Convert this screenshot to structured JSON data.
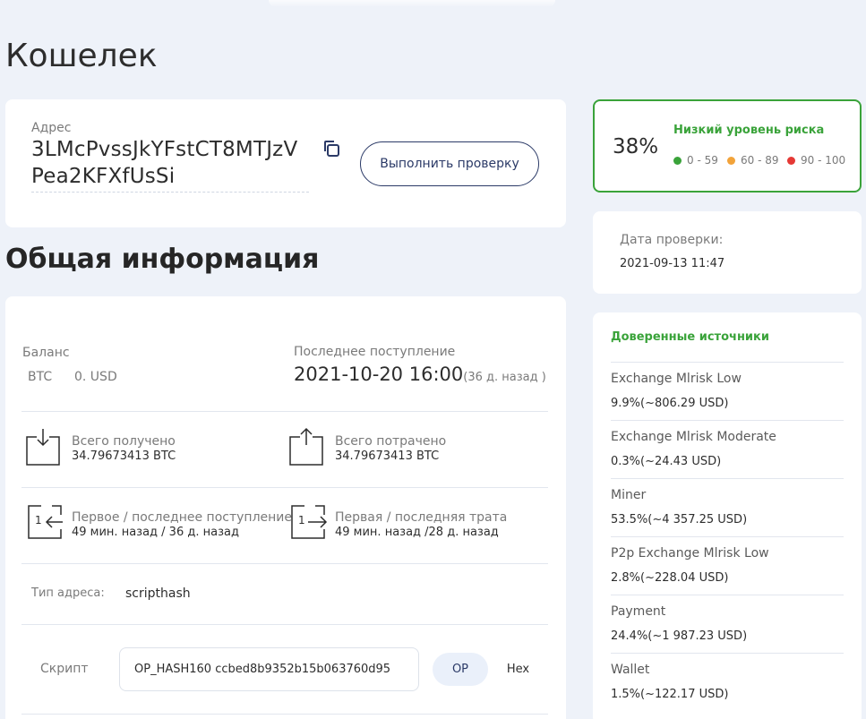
{
  "page": {
    "title": "Кошелек"
  },
  "address_card": {
    "label": "Адрес",
    "value": "3LMcPvssJkYFstCT8MTJzVPea2KFXfUsSi",
    "check_button": "Выполнить проверку"
  },
  "general": {
    "title": "Общая информация",
    "balance": {
      "label": "Баланс",
      "btc": "BTC",
      "usd": "0. USD"
    },
    "last_incoming": {
      "label": "Последнее поступление",
      "datetime": "2021-10-20 16:00",
      "ago": "(36 д. назад )"
    },
    "total_received": {
      "label": "Всего получено",
      "value": "34.79673413 BTC"
    },
    "total_spent": {
      "label": "Всего потрачено",
      "value": "34.79673413 BTC"
    },
    "first_last_incoming": {
      "label": "Первое / последнее поступление",
      "value": "49 мин. назад / 36 д. назад",
      "icon_digit": "1"
    },
    "first_last_spend": {
      "label": "Первая / последняя трата",
      "value": "49 мин. назад /28 д. назад",
      "icon_digit": "1"
    },
    "address_type": {
      "label": "Тип адреса:",
      "value": "scripthash"
    },
    "script": {
      "label": "Скрипт",
      "value": "OP_HASH160 ccbed8b9352b15b063760d95",
      "op": "OP",
      "hex": "Hex"
    }
  },
  "risk": {
    "percent": "38%",
    "level": "Низкий уровень риска",
    "legend": [
      {
        "range": "0 - 59",
        "color": "#3aa33a"
      },
      {
        "range": "60 - 89",
        "color": "#f2a33a"
      },
      {
        "range": "90 - 100",
        "color": "#e53935"
      }
    ]
  },
  "check_date": {
    "label": "Дата проверки:",
    "value": "2021-09-13 11:47"
  },
  "sources": {
    "title": "Доверенные источники",
    "items": [
      {
        "name": "Exchange Mlrisk Low",
        "value": "9.9%(~806.29 USD)"
      },
      {
        "name": "Exchange Mlrisk Moderate",
        "value": "0.3%(~24.43 USD)"
      },
      {
        "name": "Miner",
        "value": "53.5%(~4 357.25 USD)"
      },
      {
        "name": "P2p Exchange Mlrisk Low",
        "value": "2.8%(~228.04 USD)"
      },
      {
        "name": "Payment",
        "value": "24.4%(~1 987.23 USD)"
      },
      {
        "name": "Wallet",
        "value": "1.5%(~122.17 USD)"
      }
    ]
  },
  "colors": {
    "accent_green": "#3aa33a",
    "button_navy": "#2b3a67",
    "background": "#eef2f9"
  }
}
